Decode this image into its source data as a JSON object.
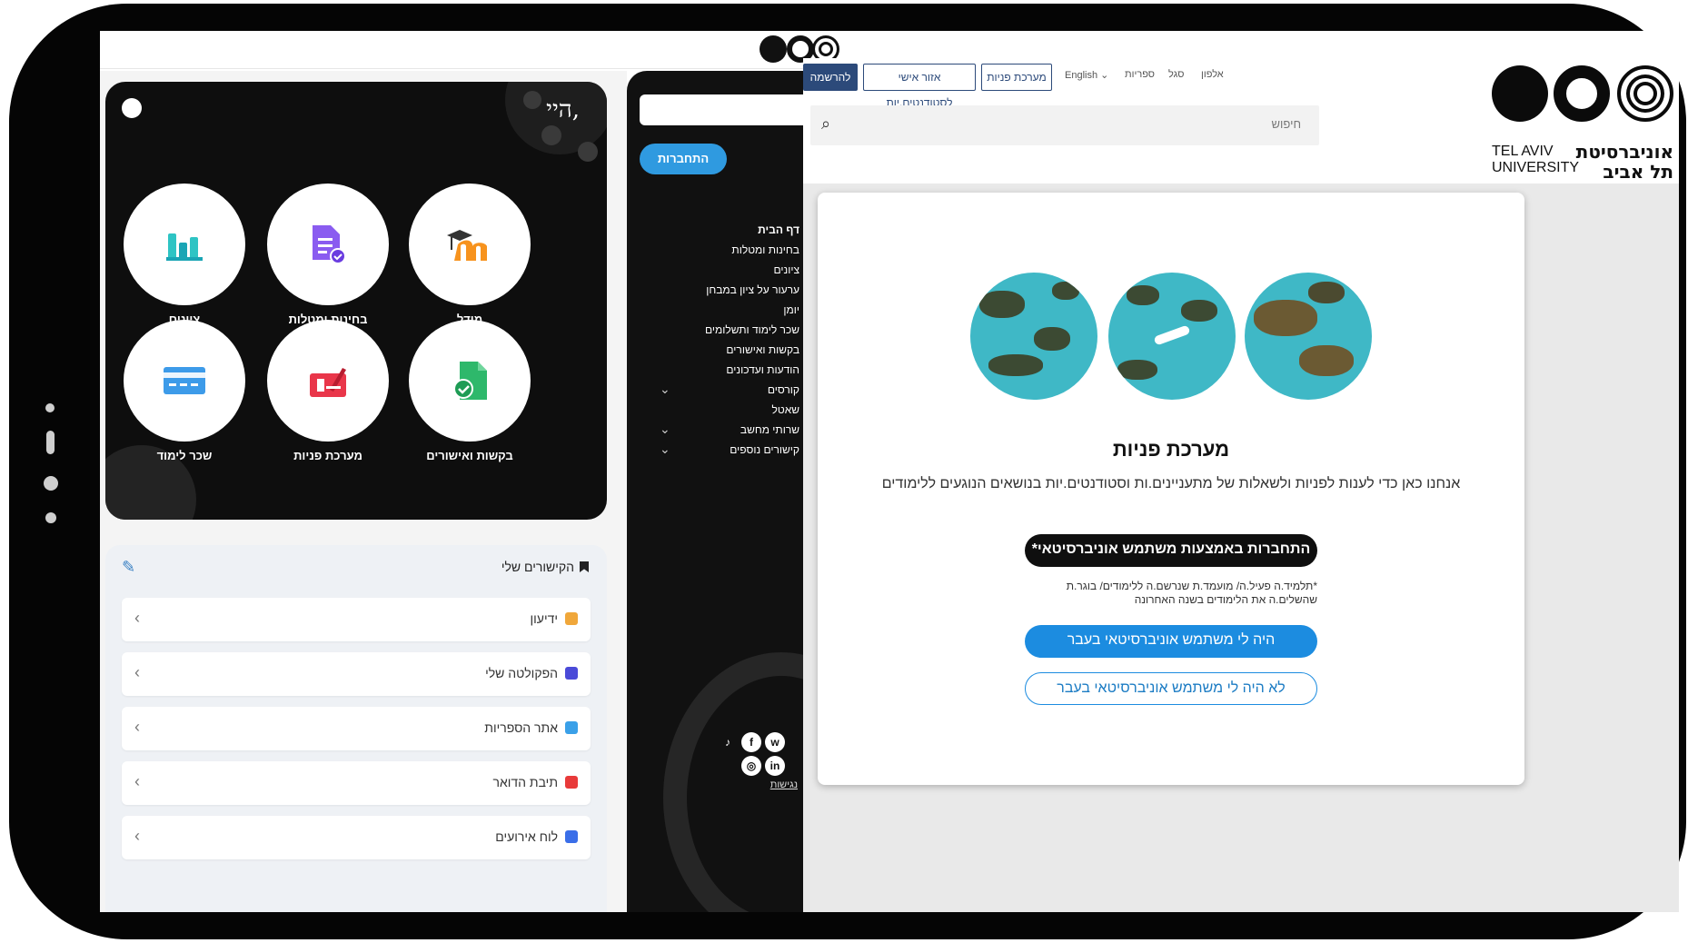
{
  "app": {
    "greeting": "היי,",
    "tiles": [
      {
        "label": "ציונים",
        "icon": "bar-chart-icon"
      },
      {
        "label": "בחינות ומטלות",
        "icon": "document-check-icon"
      },
      {
        "label": "מודל",
        "icon": "moodle-icon"
      },
      {
        "label": "שכר לימוד",
        "icon": "credit-card-icon"
      },
      {
        "label": "מערכת פניות",
        "icon": "inquiry-pen-icon"
      },
      {
        "label": "בקשות ואישורים",
        "icon": "approved-document-icon"
      }
    ],
    "links_title": "הקישורים שלי",
    "links": [
      {
        "label": "ידיעון",
        "color": "#f0a73a"
      },
      {
        "label": "הפקולטה שלי",
        "color": "#4a4ad8"
      },
      {
        "label": "אתר הספריות",
        "color": "#3aa0e8"
      },
      {
        "label": "תיבת הדואר",
        "color": "#e83a3a"
      },
      {
        "label": "לוח אירועים",
        "color": "#3a6ee8"
      }
    ]
  },
  "menu": {
    "login_label": "התחברות",
    "items": [
      "דף הבית",
      "בחינות ומטלות",
      "ציונים",
      "ערעור על ציון במבחן",
      "יומן",
      "שכר לימוד ותשלומים",
      "בקשות ואישורים",
      "הודעות ועדכונים",
      "קורסים",
      "שאטל",
      "שרותי מחשב",
      "קישורים נוספים"
    ],
    "footer_link": "נגישות"
  },
  "site": {
    "top_buttons": {
      "register": "להרשמה",
      "personal_area": "אזור אישי לסטודנטים.יות",
      "inquiry_system": "מערכת פניות"
    },
    "top_links": {
      "language": "English",
      "libraries": "ספריות",
      "staff": "סגל",
      "directory": "אלפון"
    },
    "search_placeholder": "חיפוש",
    "logo_he": "אוניברסיטת תל אביב",
    "logo_en": "TEL AVIV UNIVERSITY",
    "modal": {
      "title": "מערכת פניות",
      "subtitle": "אנחנו כאן כדי לענות לפניות ולשאלות של מתעניינים.ות וסטודנטים.יות בנושאים הנוגעים ללימודים",
      "cta_university": "התחברות באמצעות משתמש אוניברסיטאי*",
      "note": "*תלמיד.ה פעיל.ה/ מועמד.ת שנרשם.ה ללימודים/ בוגר.ת שהשלים.ה את הלימודים בשנה האחרונה",
      "cta_had_user": "היה לי משתמש אוניברסיטאי בעבר",
      "cta_no_user": "לא היה לי משתמש אוניברסיטאי בעבר"
    }
  }
}
